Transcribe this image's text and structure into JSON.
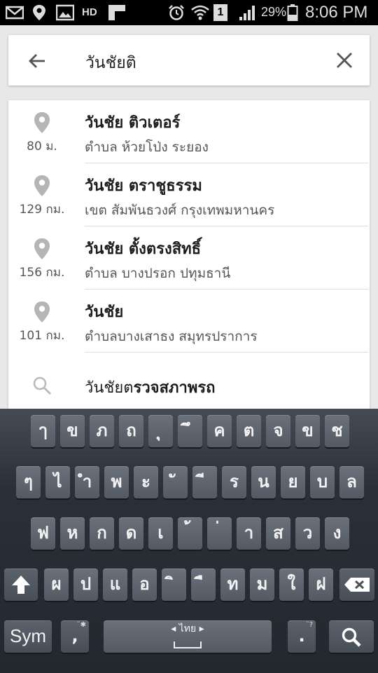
{
  "status_bar": {
    "battery_percent": "29%",
    "time": "8:06 PM",
    "sim_slot": "1",
    "hd_label": "HD",
    "icons": [
      "mail-icon",
      "location-icon",
      "image-icon",
      "hd-icon",
      "app-icon",
      "alarm-icon",
      "wifi-icon",
      "sim-icon",
      "signal-icon",
      "battery-icon"
    ]
  },
  "search": {
    "query": "วันชัยติ",
    "back_icon": "arrow-left-icon",
    "clear_icon": "close-icon"
  },
  "results": [
    {
      "name": "วันชัย ติวเตอร์",
      "address": "ตำบล ห้วยโป่ง ระยอง",
      "distance": "80 ม."
    },
    {
      "name": "วันชัย ตราชูธรรม",
      "address": "เขต สัมพันธวงศ์ กรุงเทพมหานคร",
      "distance": "129 กม."
    },
    {
      "name": "วันชัย ตั้งตรงสิทธิ์",
      "address": "ตำบล บางปรอก ปทุมธานี",
      "distance": "156 กม."
    },
    {
      "name": "วันชัย",
      "address": "ตำบลบางเสาธง สมุทรปราการ",
      "distance": "101 กม."
    }
  ],
  "suggestion": {
    "prefix": "วันชัยต",
    "rest": "รวจสภาพรถ"
  },
  "keyboard": {
    "row1": [
      "ๅ",
      "ข",
      "ภ",
      "ถ",
      "ุ",
      "ึ",
      "ค",
      "ต",
      "จ",
      "ข",
      "ช"
    ],
    "row2": [
      "ๆ",
      "ไ",
      "ำ",
      "พ",
      "ะ",
      "ั",
      "ี",
      "ร",
      "น",
      "ย",
      "บ",
      "ล"
    ],
    "row3": [
      "ฟ",
      "ห",
      "ก",
      "ด",
      "เ",
      "้",
      "่",
      "า",
      "ส",
      "ว",
      "ง"
    ],
    "row4": [
      "ผ",
      "ป",
      "แ",
      "อ",
      "ิ",
      "ื",
      "ท",
      "ม",
      "ใ",
      "ฝ"
    ],
    "sym_label": "Sym",
    "comma": ",",
    "period": ".",
    "comma_hint": "¨✱",
    "period_hint": "¨?",
    "space_label": "ไทย",
    "colors": {
      "key": "#5f6670",
      "keyboard_bg": "#2b3038"
    }
  }
}
